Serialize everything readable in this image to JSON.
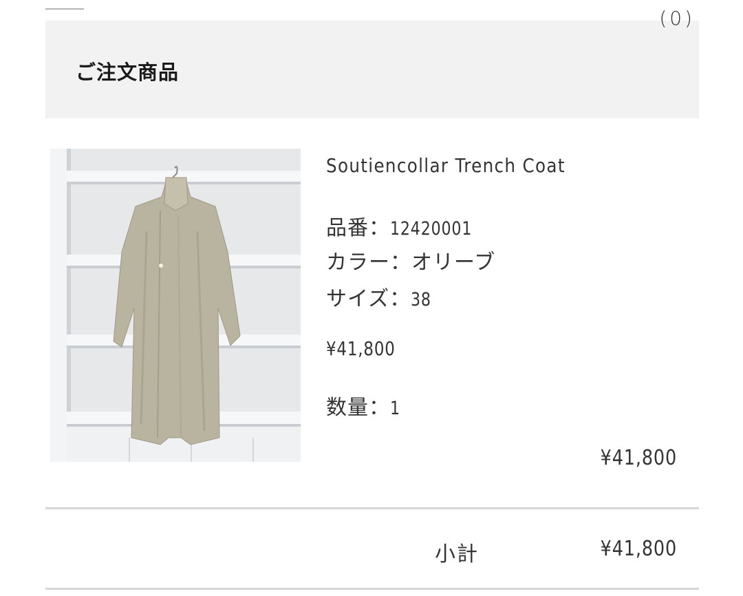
{
  "header": {
    "menu_icon": "hamburger-menu-icon",
    "cart_count": "(0)"
  },
  "section": {
    "title": "ご注文商品"
  },
  "product": {
    "name": "Soutiencollar Trench Coat",
    "code_label": "品番：",
    "code_value": "12420001",
    "color_label": "カラー：",
    "color_value": "オリーブ",
    "size_label": "サイズ：",
    "size_value": "38",
    "unit_price": "¥41,800",
    "qty_label": "数量：",
    "qty_value": "1",
    "line_total": "¥41,800",
    "image_colors": {
      "coat": "#b9b5a0",
      "shelf": "#f4f5f6",
      "wall": "#e3e5e7"
    }
  },
  "summary": {
    "subtotal_label": "小計",
    "subtotal_value": "¥41,800"
  }
}
